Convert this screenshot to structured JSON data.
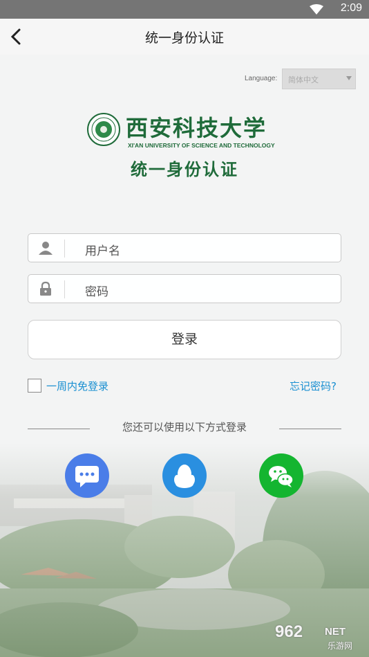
{
  "status_bar": {
    "time": "2:09"
  },
  "app_bar": {
    "title": "统一身份认证"
  },
  "language": {
    "label": "Language:",
    "selected": "简体中文"
  },
  "logo": {
    "name_cn": "西安科技大学",
    "name_en": "XI'AN UNIVERSITY OF SCIENCE AND TECHNOLOGY"
  },
  "heading": "统一身份认证",
  "form": {
    "username_placeholder": "用户名",
    "password_placeholder": "密码",
    "login_label": "登录",
    "remember_label": "一周内免登录",
    "forgot_label": "忘记密码?"
  },
  "alt_login": {
    "text": "您还可以使用以下方式登录"
  },
  "watermark": {
    "num": "962",
    "net": "NET",
    "sub": "乐游网"
  },
  "colors": {
    "brand_green": "#1f6b3a",
    "link_blue": "#1a8fd1",
    "sms_blue": "#4a7de8",
    "qq_blue": "#2a8fe0",
    "wechat_green": "#14b530"
  }
}
